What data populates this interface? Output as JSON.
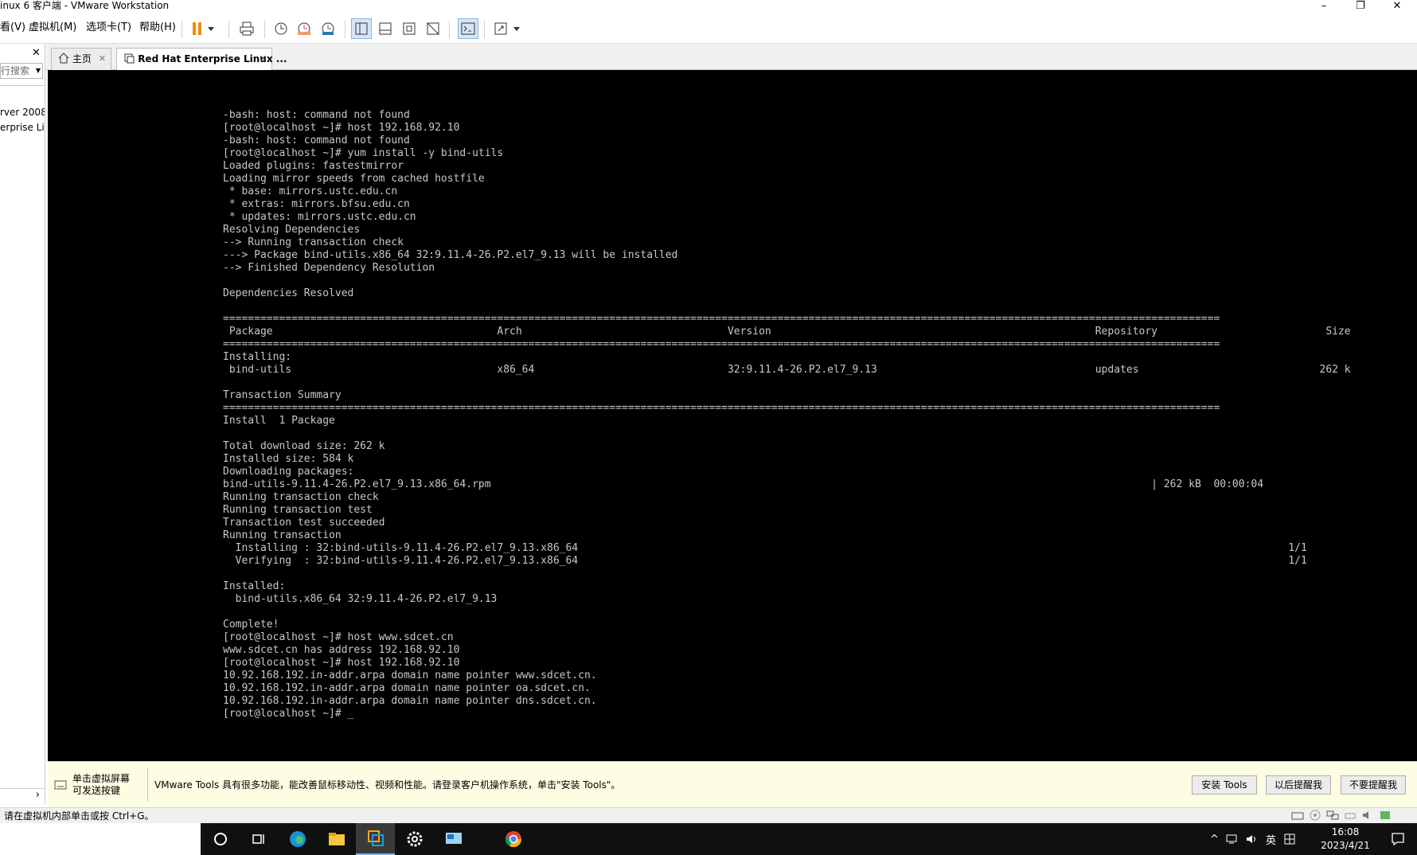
{
  "window": {
    "title": "inux 6 客户端 - VMware Workstation",
    "minimize": "–",
    "restore": "❐",
    "close": "✕"
  },
  "menu": {
    "items": [
      "看(V)",
      "虚拟机(M)",
      "选项卡(T)",
      "帮助(H)"
    ]
  },
  "library": {
    "close": "✕",
    "search_placeholder": "在此处键入内容进行搜索",
    "search_visible": "行搜索",
    "items": [
      "rver 2008",
      "erprise Li"
    ],
    "scroll_arrow": "›"
  },
  "tabs": [
    {
      "label": "主页",
      "close": "✕"
    },
    {
      "label": "Red Hat Enterprise Linux ...",
      "close": "✕"
    }
  ],
  "terminal": {
    "lines": [
      "-bash: host: command not found",
      "[root@localhost ~]# host 192.168.92.10",
      "-bash: host: command not found",
      "[root@localhost ~]# yum install -y bind-utils",
      "Loaded plugins: fastestmirror",
      "Loading mirror speeds from cached hostfile",
      " * base: mirrors.ustc.edu.cn",
      " * extras: mirrors.bfsu.edu.cn",
      " * updates: mirrors.ustc.edu.cn",
      "Resolving Dependencies",
      "--> Running transaction check",
      "---> Package bind-utils.x86_64 32:9.11.4-26.P2.el7_9.13 will be installed",
      "--> Finished Dependency Resolution",
      "",
      "Dependencies Resolved",
      "",
      "================================================================================================================================================================",
      " Package                                    Arch                                 Version                                                    Repository                           Size",
      "================================================================================================================================================================",
      "Installing:",
      " bind-utils                                 x86_64                               32:9.11.4-26.P2.el7_9.13                                   updates                             262 k",
      "",
      "Transaction Summary",
      "================================================================================================================================================================",
      "Install  1 Package",
      "",
      "Total download size: 262 k",
      "Installed size: 584 k",
      "Downloading packages:",
      "bind-utils-9.11.4-26.P2.el7_9.13.x86_64.rpm                                                                                                          | 262 kB  00:00:04",
      "Running transaction check",
      "Running transaction test",
      "Transaction test succeeded",
      "Running transaction",
      "  Installing : 32:bind-utils-9.11.4-26.P2.el7_9.13.x86_64                                                                                                                  1/1",
      "  Verifying  : 32:bind-utils-9.11.4-26.P2.el7_9.13.x86_64                                                                                                                  1/1",
      "",
      "Installed:",
      "  bind-utils.x86_64 32:9.11.4-26.P2.el7_9.13",
      "",
      "Complete!",
      "[root@localhost ~]# host www.sdcet.cn",
      "www.sdcet.cn has address 192.168.92.10",
      "[root@localhost ~]# host 192.168.92.10",
      "10.92.168.192.in-addr.arpa domain name pointer www.sdcet.cn.",
      "10.92.168.192.in-addr.arpa domain name pointer oa.sdcet.cn.",
      "10.92.168.192.in-addr.arpa domain name pointer dns.sdcet.cn.",
      "[root@localhost ~]# _"
    ]
  },
  "notice": {
    "hint_line1": "单击虚拟屏幕",
    "hint_line2": "可发送按键",
    "message": "VMware Tools 具有很多功能，能改善鼠标移动性、视频和性能。请登录客户机操作系统，单击\"安装 Tools\"。",
    "install_button": "安装 Tools",
    "remind_later_button": "以后提醒我",
    "never_remind_button": "不要提醒我"
  },
  "status": {
    "text": "请在虚拟机内部单击或按 Ctrl+G。"
  },
  "taskbar": {
    "tray": [
      "^",
      "英"
    ],
    "time": "16:08",
    "date": "2023/4/21"
  },
  "colors": {
    "console_bg": "#000000",
    "terminal_text": "#c8c8c8",
    "notice_bg": "#fdfde3",
    "pause_orange": "#f08c00",
    "taskbar_bg": "#101010"
  }
}
